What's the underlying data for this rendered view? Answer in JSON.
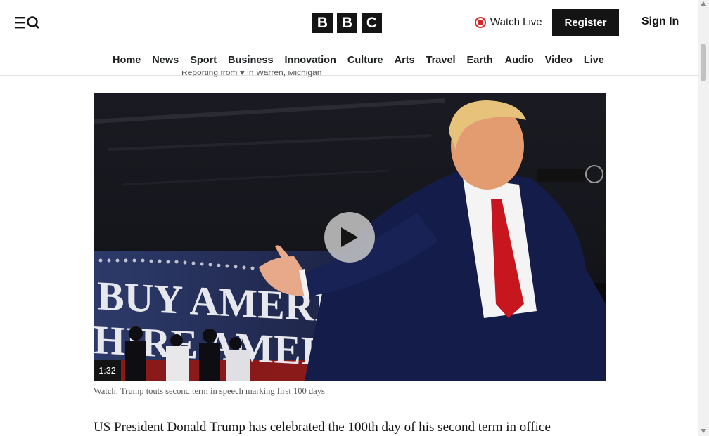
{
  "header": {
    "menu_icon": "menu-icon",
    "search_icon": "search-icon",
    "logo": [
      "B",
      "B",
      "C"
    ],
    "watch_live": "Watch Live",
    "register": "Register",
    "sign_in": "Sign In",
    "live_color": "#d42828"
  },
  "nav": {
    "items": [
      "Home",
      "News",
      "Sport",
      "Business",
      "Innovation",
      "Culture",
      "Arts",
      "Travel",
      "Earth",
      "Audio",
      "Video",
      "Live"
    ]
  },
  "article": {
    "reporting": "Reporting from ♥ in Warren, Michigan",
    "video": {
      "duration": "1:32",
      "play_icon": "play-icon",
      "banner_line1": "BUY AMERICAN",
      "banner_line2": "HIRE AMERICAN"
    },
    "caption": "Watch: Trump touts second term in speech marking first 100 days",
    "first_paragraph": "US President Donald Trump has celebrated the 100th day of his second term in office"
  }
}
